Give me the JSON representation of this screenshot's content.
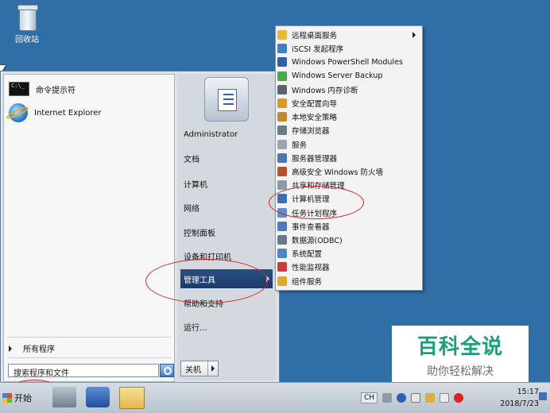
{
  "desktop": {
    "recycle_bin_label": "回收站"
  },
  "start_menu": {
    "pinned": [
      {
        "label": "命令提示符",
        "icon": "command-prompt-icon"
      },
      {
        "label": "Internet Explorer",
        "icon": "internet-explorer-icon"
      }
    ],
    "all_programs_label": "所有程序",
    "search_placeholder": "搜索程序和文件",
    "right_items": [
      {
        "label": "Administrator"
      },
      {
        "label": "文档"
      },
      {
        "label": "计算机"
      },
      {
        "label": "网络"
      },
      {
        "label": "控制面板"
      },
      {
        "label": "设备和打印机"
      },
      {
        "label": "管理工具",
        "highlighted": true,
        "has_submenu": true
      },
      {
        "label": "帮助和支持"
      },
      {
        "label": "运行..."
      }
    ],
    "shutdown_label": "关机"
  },
  "admin_tools_submenu": {
    "items": [
      {
        "label": "远程桌面服务",
        "icon": "folder-icon",
        "color": "#e8b935",
        "has_submenu": true
      },
      {
        "label": "iSCSI 发起程序",
        "icon": "iscsi-icon",
        "color": "#3c7fc4"
      },
      {
        "label": "Windows PowerShell Modules",
        "icon": "powershell-icon",
        "color": "#2e5fa8"
      },
      {
        "label": "Windows Server Backup",
        "icon": "backup-icon",
        "color": "#4ea84a"
      },
      {
        "label": "Windows 内存诊断",
        "icon": "memory-diagnostic-icon",
        "color": "#5a6470"
      },
      {
        "label": "安全配置向导",
        "icon": "security-wizard-icon",
        "color": "#d89a2c"
      },
      {
        "label": "本地安全策略",
        "icon": "local-security-policy-icon",
        "color": "#c78a2a"
      },
      {
        "label": "存储浏览器",
        "icon": "storage-explorer-icon",
        "color": "#6a7b8c"
      },
      {
        "label": "服务",
        "icon": "services-icon",
        "color": "#9aa6b2"
      },
      {
        "label": "服务器管理器",
        "icon": "server-manager-icon",
        "color": "#4a78b0"
      },
      {
        "label": "高级安全 Windows 防火墙",
        "icon": "firewall-icon",
        "color": "#b8502c"
      },
      {
        "label": "共享和存储管理",
        "icon": "share-storage-icon",
        "color": "#8a9aa8"
      },
      {
        "label": "计算机管理",
        "icon": "computer-management-icon",
        "color": "#3b6db2"
      },
      {
        "label": "任务计划程序",
        "icon": "task-scheduler-icon",
        "color": "#5b8fcf"
      },
      {
        "label": "事件查看器",
        "icon": "event-viewer-icon",
        "color": "#4f79b8"
      },
      {
        "label": "数据源(ODBC)",
        "icon": "odbc-icon",
        "color": "#6a7a8c"
      },
      {
        "label": "系统配置",
        "icon": "system-config-icon",
        "color": "#4c86c6"
      },
      {
        "label": "性能监视器",
        "icon": "performance-monitor-icon",
        "color": "#c83c3c"
      },
      {
        "label": "组件服务",
        "icon": "component-services-icon",
        "color": "#e0a82e"
      }
    ]
  },
  "taskbar": {
    "start_label": "开始",
    "language": "CH",
    "clock_time": "15:17",
    "clock_date": "2018/7/23"
  },
  "watermark": {
    "title": "百科全说",
    "subtitle": "助你轻松解决"
  },
  "colors": {
    "desktop": "#2f6ea7",
    "highlight": "#1c3a6a",
    "annotation": "#d42020",
    "watermark": "#1a9e7c"
  }
}
